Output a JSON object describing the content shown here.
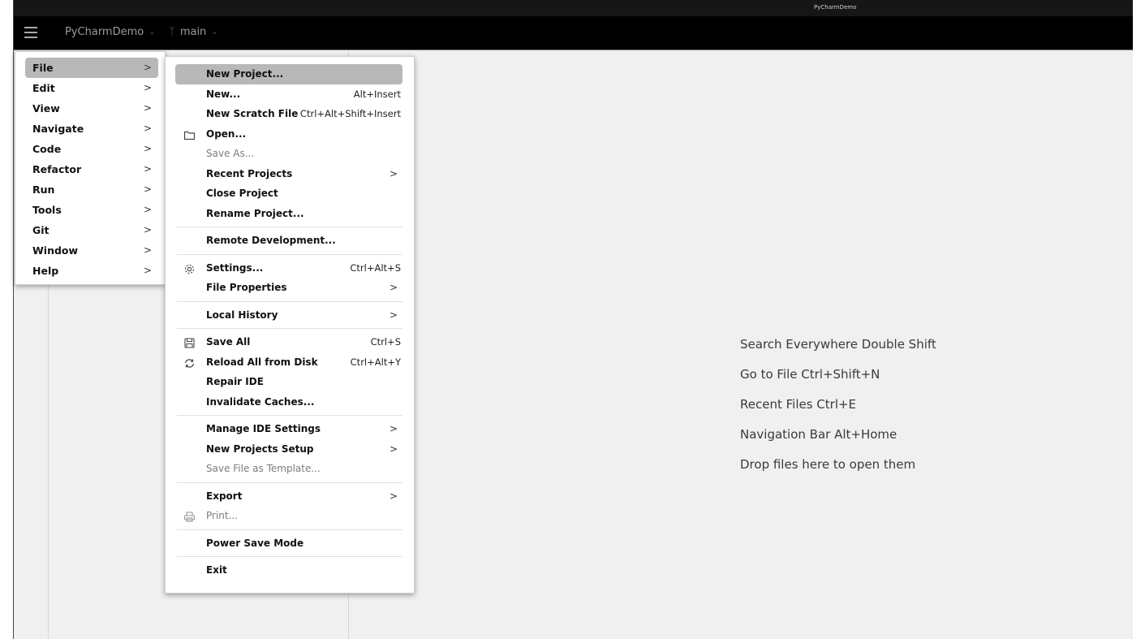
{
  "window": {
    "title": "PyCharmDemo"
  },
  "toolbar": {
    "menu_icon": "hamburger-icon",
    "project_name": "PyCharmDemo",
    "branch_icon": "git-branch-icon",
    "branch_name": "main",
    "dropdown_icon": "chevron-down-icon"
  },
  "main_menu": {
    "items": [
      {
        "label": "File",
        "selected": true
      },
      {
        "label": "Edit"
      },
      {
        "label": "View"
      },
      {
        "label": "Navigate"
      },
      {
        "label": "Code"
      },
      {
        "label": "Refactor"
      },
      {
        "label": "Run"
      },
      {
        "label": "Tools"
      },
      {
        "label": "Git"
      },
      {
        "label": "Window"
      },
      {
        "label": "Help"
      }
    ],
    "submenu_arrow": ">"
  },
  "file_menu": {
    "items": {
      "new_project": {
        "label": "New Project..."
      },
      "new": {
        "label": "New...",
        "shortcut": "Alt+Insert"
      },
      "new_scratch": {
        "label": "New Scratch File",
        "shortcut": "Ctrl+Alt+Shift+Insert"
      },
      "open": {
        "label": "Open...",
        "icon": "folder-icon"
      },
      "save_as": {
        "label": "Save As..."
      },
      "recent_projects": {
        "label": "Recent Projects"
      },
      "close_project": {
        "label": "Close Project"
      },
      "rename_project": {
        "label": "Rename Project..."
      },
      "remote_dev": {
        "label": "Remote Development..."
      },
      "settings": {
        "label": "Settings...",
        "shortcut": "Ctrl+Alt+S",
        "icon": "gear-icon"
      },
      "file_properties": {
        "label": "File Properties"
      },
      "local_history": {
        "label": "Local History"
      },
      "save_all": {
        "label": "Save All",
        "shortcut": "Ctrl+S",
        "icon": "save-icon"
      },
      "reload": {
        "label": "Reload All from Disk",
        "shortcut": "Ctrl+Alt+Y",
        "icon": "reload-icon"
      },
      "repair_ide": {
        "label": "Repair IDE"
      },
      "invalidate_caches": {
        "label": "Invalidate Caches..."
      },
      "manage_ide_settings": {
        "label": "Manage IDE Settings"
      },
      "new_projects_setup": {
        "label": "New Projects Setup"
      },
      "save_template": {
        "label": "Save File as Template..."
      },
      "export": {
        "label": "Export"
      },
      "print": {
        "label": "Print...",
        "icon": "printer-icon"
      },
      "power_save": {
        "label": "Power Save Mode"
      },
      "exit": {
        "label": "Exit"
      }
    },
    "submenu_arrow": ">"
  },
  "editor_hints": [
    "Search Everywhere Double Shift",
    "Go to File Ctrl+Shift+N",
    "Recent Files Ctrl+E",
    "Navigation Bar Alt+Home",
    "Drop files here to open them"
  ]
}
